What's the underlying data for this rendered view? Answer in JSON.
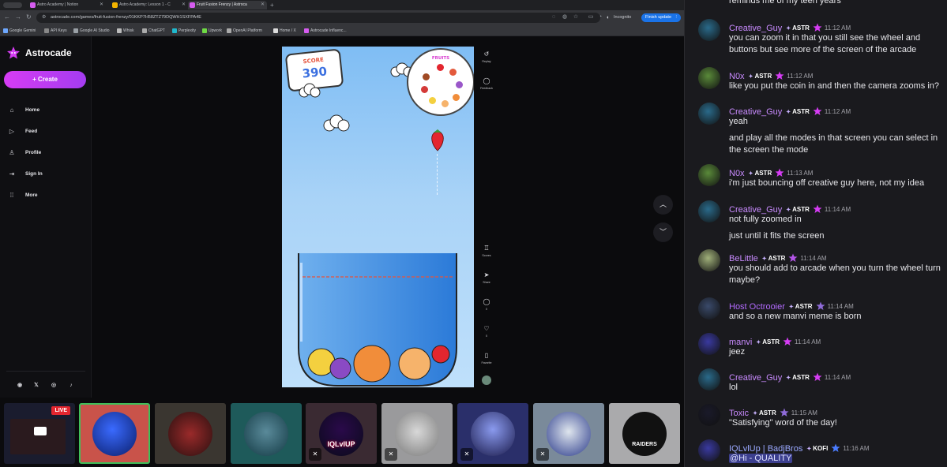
{
  "browser": {
    "tabs": [
      {
        "title": "Astro Academy | Notion",
        "active": false
      },
      {
        "title": "Astro Academy: Lesson 1 - C",
        "active": false
      },
      {
        "title": "Fruit Fusion Frenzy | Astroca",
        "active": true
      }
    ],
    "url": "astrocade.com/games/fruit-fusion-frenzy/01KKP7H58ZTZ79DQWH1SXFPA4E",
    "incognito": "Incognito",
    "finish_update": "Finish update",
    "bookmarks": [
      "Google Gemini",
      "API Keys",
      "Google AI Studio",
      "Whisk",
      "ChatGPT",
      "Perplexity",
      "Upwork",
      "OpenAI Platform",
      "Home / X",
      "Astrocade Influenc..."
    ]
  },
  "site": {
    "brand": "Astrocade",
    "create": "Create",
    "nav": [
      "Home",
      "Feed",
      "Profile",
      "Sign In",
      "More"
    ],
    "socials": [
      "discord-icon",
      "x-icon",
      "instagram-icon",
      "tiktok-icon"
    ]
  },
  "game": {
    "score_label": "SCORE",
    "score": "390",
    "fruits_label": "FRUITS",
    "controls": [
      {
        "icon": "replay-icon",
        "label": "Replay"
      },
      {
        "icon": "feedback-icon",
        "label": "Feedback"
      },
      {
        "icon": "scores-icon",
        "label": "Scores"
      },
      {
        "icon": "share-icon",
        "label": "Share"
      },
      {
        "icon": "comment-icon",
        "label": "0"
      },
      {
        "icon": "heart-icon",
        "label": "0"
      },
      {
        "icon": "favorite-icon",
        "label": "Favorite"
      }
    ]
  },
  "strip": {
    "live": "LIVE",
    "iql_text": "IQLvlUP",
    "raiders_text": "RAIDERS"
  },
  "chat": {
    "top_partial": "reminds me of my teen years",
    "messages": [
      {
        "user": "Creative_Guy",
        "color": "#c98bff",
        "tag": "ASTR",
        "badge": "#d63cf4",
        "time": "11:12 AM",
        "lines": [
          "you can zoom it in that you still see the wheel and buttons but see more of the screen of the arcade"
        ]
      },
      {
        "user": "N0x",
        "color": "#c98bff",
        "tag": "ASTR",
        "badge": "#d63cf4",
        "time": "11:12 AM",
        "lines": [
          "like you put the coin in and then the camera zooms in?"
        ]
      },
      {
        "user": "Creative_Guy",
        "color": "#c98bff",
        "tag": "ASTR",
        "badge": "#d63cf4",
        "time": "11:12 AM",
        "lines": [
          "yeah",
          "and play all the modes in that screen you can select in the screen the mode"
        ]
      },
      {
        "user": "N0x",
        "color": "#c98bff",
        "tag": "ASTR",
        "badge": "#d63cf4",
        "time": "11:13 AM",
        "lines": [
          "i'm just bouncing off creative guy here, not my idea"
        ]
      },
      {
        "user": "Creative_Guy",
        "color": "#c98bff",
        "tag": "ASTR",
        "badge": "#d63cf4",
        "time": "11:14 AM",
        "lines": [
          "not fully zoomed in",
          "just until it fits the screen"
        ]
      },
      {
        "user": "BeLittle",
        "color": "#c98bff",
        "tag": "ASTR",
        "badge": "#b455e8",
        "time": "11:14 AM",
        "lines": [
          "you should add to arcade when you turn the wheel turn maybe?"
        ]
      },
      {
        "user": "Host Octrooier",
        "color": "#b36bff",
        "tag": "ASTR",
        "badge": "#8f6bd8",
        "time": "11:14 AM",
        "lines": [
          "and so a new manvi meme is born"
        ]
      },
      {
        "user": "manvi",
        "color": "#c98bff",
        "tag": "ASTR",
        "badge": "#d63cf4",
        "time": "11:14 AM",
        "lines": [
          "jeez"
        ]
      },
      {
        "user": "Creative_Guy",
        "color": "#c98bff",
        "tag": "ASTR",
        "badge": "#d63cf4",
        "time": "11:14 AM",
        "lines": [
          "lol"
        ]
      },
      {
        "user": "Toxic",
        "color": "#c98bff",
        "tag": "ASTR",
        "badge": "#8f6bd8",
        "time": "11:15 AM",
        "lines": [
          "\"Satisfying\" word of the day!"
        ]
      },
      {
        "user": "IQLvlUp | BadjBros",
        "color": "#9aa8ff",
        "tag": "KOFI",
        "badge": "#4a7cff",
        "time": "11:16 AM",
        "lines": [
          "@Hi - QUALITY"
        ]
      }
    ]
  }
}
